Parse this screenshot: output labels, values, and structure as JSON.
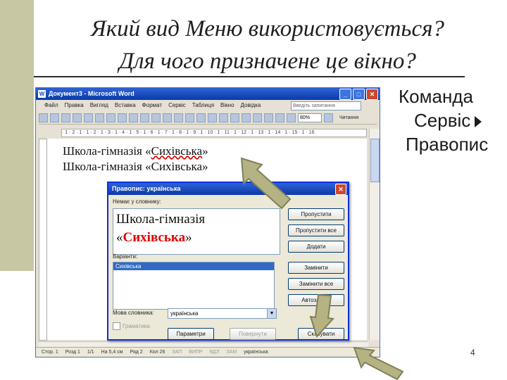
{
  "slide": {
    "title_line1": "Який вид Меню використовується?",
    "title_line2": "Для чого призначене це вікно?",
    "side_line1": "Команда",
    "side_line2": "Сервіс",
    "side_line3": "Правопис",
    "page_number": "4"
  },
  "word": {
    "window_title": "Документ3 - Microsoft Word",
    "menu": [
      "Файл",
      "Правка",
      "Вигляд",
      "Вставка",
      "Формат",
      "Сервіс",
      "Таблиця",
      "Вікно",
      "Довідка"
    ],
    "help_placeholder": "Введіть запитання",
    "zoom": "80%",
    "read_button": "Читання",
    "doc_line1_pre": "Школа-гімназія «",
    "doc_line1_err": "Сихівська",
    "doc_line1_post": "»",
    "doc_line2": "Школа-гімназія «Сихівська»",
    "status": {
      "page": "Стор. 1",
      "section": "Розд 1",
      "pages": "1/1",
      "at": "На 5,4 см",
      "line": "Ряд 2",
      "col": "Кол 26",
      "rec": "ЗАП",
      "trk": "ВИПР",
      "ext": "ВДЛ",
      "ovr": "ЗАМ",
      "lang": "українська"
    }
  },
  "dialog": {
    "title": "Правопис: українська",
    "not_in_dict_label": "Немає у словнику:",
    "text_line1": "Школа-гімназія",
    "text_quote_open": "«",
    "text_bad_word": "Сихівська",
    "text_quote_close": "»",
    "suggestions_label": "Варіанти:",
    "suggestion_selected": "Сихівська",
    "buttons": {
      "skip": "Пропустити",
      "skip_all": "Пропустити все",
      "add": "Додати",
      "change": "Замінити",
      "change_all": "Замінити все",
      "autocorrect": "Автозаміна"
    },
    "dict_lang_label": "Мова словника:",
    "dict_lang_value": "українська",
    "grammar_checkbox": "Граматика",
    "options_button": "Параметри",
    "undo_button": "Повернути",
    "cancel_button": "Скасувати"
  }
}
